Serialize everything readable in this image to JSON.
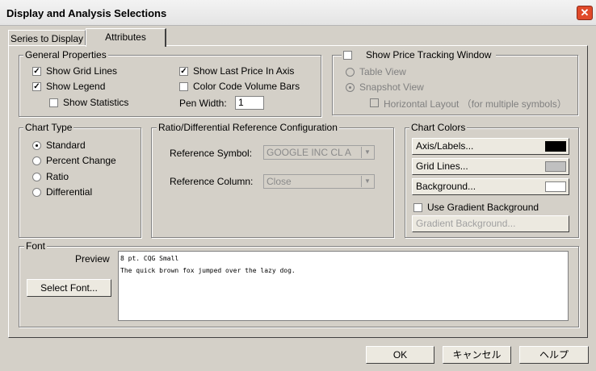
{
  "window": {
    "title": "Display and Analysis Selections",
    "close_glyph": "✕"
  },
  "tabs": [
    {
      "label": "Series to Display",
      "active": false
    },
    {
      "label": "Attributes",
      "active": true
    }
  ],
  "general_properties": {
    "legend": "General Properties",
    "show_grid_lines": {
      "label": "Show Grid Lines",
      "checked": true
    },
    "show_legend": {
      "label": "Show Legend",
      "checked": true
    },
    "show_statistics": {
      "label": "Show Statistics",
      "checked": false
    },
    "show_last_price": {
      "label": "Show Last Price In Axis",
      "checked": true
    },
    "color_code_volume": {
      "label": "Color Code Volume Bars",
      "checked": false
    },
    "pen_width_label": "Pen Width:",
    "pen_width_value": "1"
  },
  "price_tracking": {
    "show_label": "Show Price Tracking Window",
    "checked": false,
    "table_view": "Table View",
    "snapshot_view": "Snapshot View",
    "horizontal_layout": "Horizontal Layout （for multiple symbols）"
  },
  "chart_type": {
    "legend": "Chart Type",
    "options": [
      "Standard",
      "Percent Change",
      "Ratio",
      "Differential"
    ],
    "selected": "Standard"
  },
  "reference_config": {
    "legend": "Ratio/Differential Reference Configuration",
    "symbol_label": "Reference Symbol:",
    "symbol_value": "GOOGLE INC CL A",
    "column_label": "Reference Column:",
    "column_value": "Close"
  },
  "chart_colors": {
    "legend": "Chart Colors",
    "axis_labels": {
      "label": "Axis/Labels...",
      "color": "#000000"
    },
    "grid_lines": {
      "label": "Grid Lines...",
      "color": "#c0c0c0"
    },
    "background": {
      "label": "Background...",
      "color": "#ffffff"
    },
    "use_gradient_label": "Use Gradient Background",
    "use_gradient_checked": false,
    "gradient_button": "Gradient Background..."
  },
  "font": {
    "legend": "Font",
    "preview_label": "Preview",
    "select_button": "Select Font...",
    "preview_line1": "8 pt. CQG Small",
    "preview_line2": "The quick brown fox jumped over the lazy dog."
  },
  "footer": {
    "ok": "OK",
    "cancel": "キャンセル",
    "help": "ヘルプ"
  }
}
